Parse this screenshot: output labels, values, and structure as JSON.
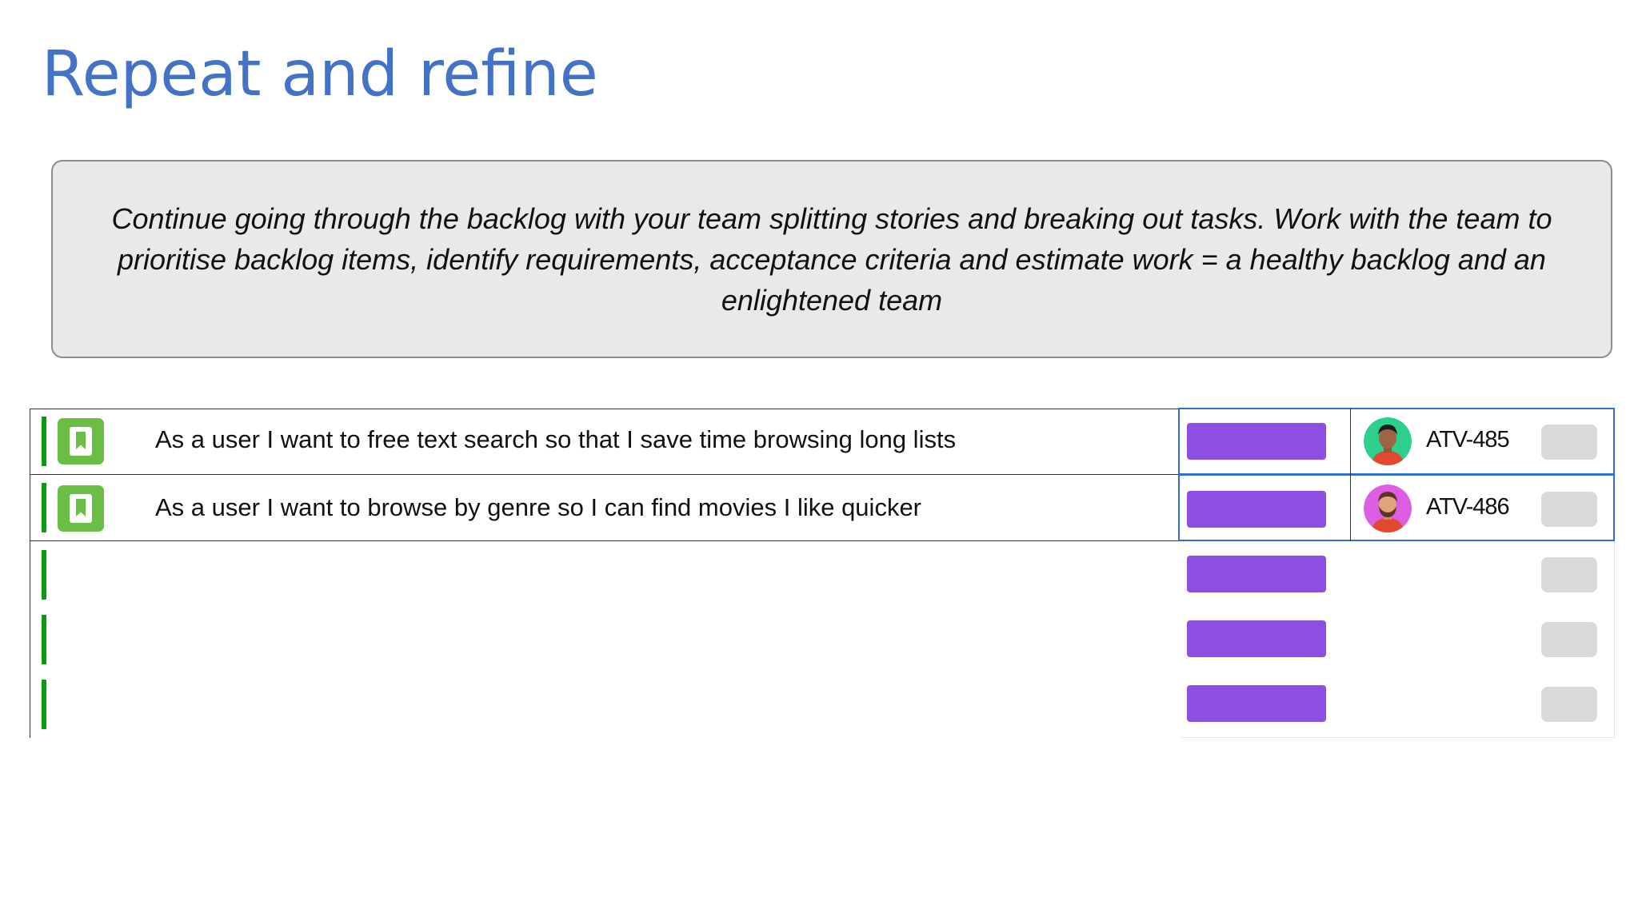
{
  "slide": {
    "title": "Repeat and refine",
    "callout": "Continue going through the backlog with your team splitting stories and breaking out tasks. Work with the team to  prioritise backlog items, identify requirements, acceptance criteria and estimate work = a healthy backlog and an  enlightened team"
  },
  "colors": {
    "title": "#4472c4",
    "priority": "#0b9a12",
    "story_icon": "#6abd45",
    "status": "#8c4fe0",
    "selection": "#2f6fd6",
    "chip": "#d9d9d9"
  },
  "backlog": {
    "items": [
      {
        "icon": "bookmark-icon",
        "summary": "As a user I want to free text search so that I save time browsing long lists",
        "assignee_icon": "avatar-man-green",
        "key": "ATV-485"
      },
      {
        "icon": "bookmark-icon",
        "summary": "As a user I want to browse by genre so I can find movies I like quicker",
        "assignee_icon": "avatar-man-pink",
        "key": "ATV-486"
      }
    ]
  }
}
